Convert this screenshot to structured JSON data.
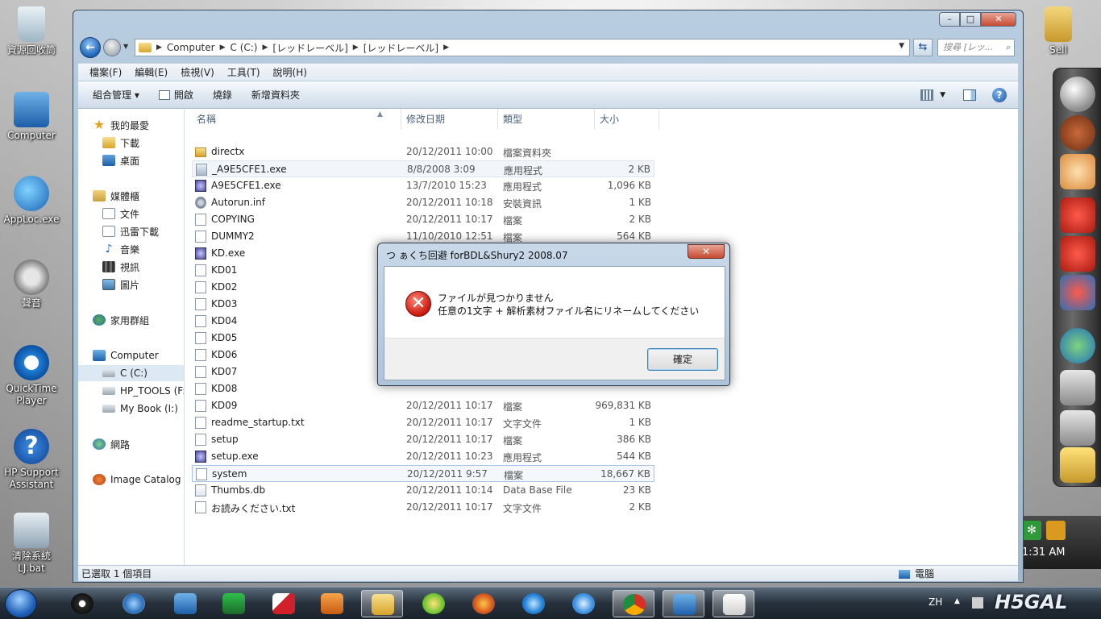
{
  "desktop": {
    "icons": [
      {
        "label": "資源回收筒"
      },
      {
        "label": "Computer"
      },
      {
        "label": "AppLoc.exe"
      },
      {
        "label": "聲音"
      },
      {
        "label": "QuickTime Player"
      },
      {
        "label": "HP Support Assistant"
      },
      {
        "label": "清除系統 LJ.bat"
      },
      {
        "label": "Sell"
      }
    ],
    "clock_time": "1:31 AM"
  },
  "explorer": {
    "breadcrumb": [
      "Computer",
      "C (C:)",
      "[レッドレーベル]",
      "[レッドレーベル]"
    ],
    "search_placeholder": "搜尋 [レッ...",
    "menu": [
      "檔案(F)",
      "編輯(E)",
      "檢視(V)",
      "工具(T)",
      "說明(H)"
    ],
    "toolbar": {
      "organize": "組合管理 ▾",
      "open": "開啟",
      "burn": "燒錄",
      "new_folder": "新增資料夾"
    },
    "nav": {
      "favorites": "我的最愛",
      "downloads": "下載",
      "desktop": "桌面",
      "libraries": "媒體櫃",
      "documents": "文件",
      "thunder": "迅雷下載",
      "music": "音樂",
      "videos": "視訊",
      "pictures": "圖片",
      "homegroup": "家用群組",
      "computer": "Computer",
      "drive_c": "C (C:)",
      "drive_hp": "HP_TOOLS (F:)",
      "drive_book": "My Book (I:)",
      "network": "網路",
      "image_catalog": "Image Catalog"
    },
    "columns": {
      "name": "名稱",
      "date": "修改日期",
      "type": "類型",
      "size": "大小"
    },
    "files": [
      {
        "name": "directx",
        "date": "20/12/2011 10:00",
        "type": "檔案資料夾",
        "size": ""
      },
      {
        "name": "_A9E5CFE1.exe",
        "date": "8/8/2008 3:09",
        "type": "應用程式",
        "size": "2 KB"
      },
      {
        "name": "A9E5CFE1.exe",
        "date": "13/7/2010 15:23",
        "type": "應用程式",
        "size": "1,096 KB"
      },
      {
        "name": "Autorun.inf",
        "date": "20/12/2011 10:18",
        "type": "安裝資訊",
        "size": "1 KB"
      },
      {
        "name": "COPYING",
        "date": "20/12/2011 10:17",
        "type": "檔案",
        "size": "2 KB"
      },
      {
        "name": "DUMMY2",
        "date": "11/10/2010 12:51",
        "type": "檔案",
        "size": "564 KB"
      },
      {
        "name": "KD.exe",
        "date": "",
        "type": "",
        "size": ""
      },
      {
        "name": "KD01",
        "date": "",
        "type": "",
        "size": ""
      },
      {
        "name": "KD02",
        "date": "",
        "type": "",
        "size": ""
      },
      {
        "name": "KD03",
        "date": "",
        "type": "",
        "size": ""
      },
      {
        "name": "KD04",
        "date": "",
        "type": "",
        "size": ""
      },
      {
        "name": "KD05",
        "date": "",
        "type": "",
        "size": ""
      },
      {
        "name": "KD06",
        "date": "",
        "type": "",
        "size": ""
      },
      {
        "name": "KD07",
        "date": "",
        "type": "",
        "size": ""
      },
      {
        "name": "KD08",
        "date": "",
        "type": "",
        "size": ""
      },
      {
        "name": "KD09",
        "date": "20/12/2011 10:17",
        "type": "檔案",
        "size": "969,831 KB"
      },
      {
        "name": "readme_startup.txt",
        "date": "20/12/2011 10:17",
        "type": "文字文件",
        "size": "1 KB"
      },
      {
        "name": "setup",
        "date": "20/12/2011 10:17",
        "type": "檔案",
        "size": "386 KB"
      },
      {
        "name": "setup.exe",
        "date": "20/12/2011 10:23",
        "type": "應用程式",
        "size": "544 KB"
      },
      {
        "name": "system",
        "date": "20/12/2011 9:57",
        "type": "檔案",
        "size": "18,667 KB"
      },
      {
        "name": "Thumbs.db",
        "date": "20/12/2011 10:14",
        "type": "Data Base File",
        "size": "23 KB"
      },
      {
        "name": "お読みください.txt",
        "date": "20/12/2011 10:17",
        "type": "文字文件",
        "size": "2 KB"
      }
    ],
    "status_left": "已選取 1 個項目",
    "status_right": "電腦"
  },
  "dialog": {
    "title": "つ ぁくち回避 forBDL&Shury2 2008.07",
    "line1": "ファイルが見つかりません",
    "line2": "任意の1文字 + 解析素材ファイル名にリネームしてください",
    "ok": "確定"
  },
  "taskbar": {
    "lang": "ZH",
    "brand": "H5GAL"
  }
}
